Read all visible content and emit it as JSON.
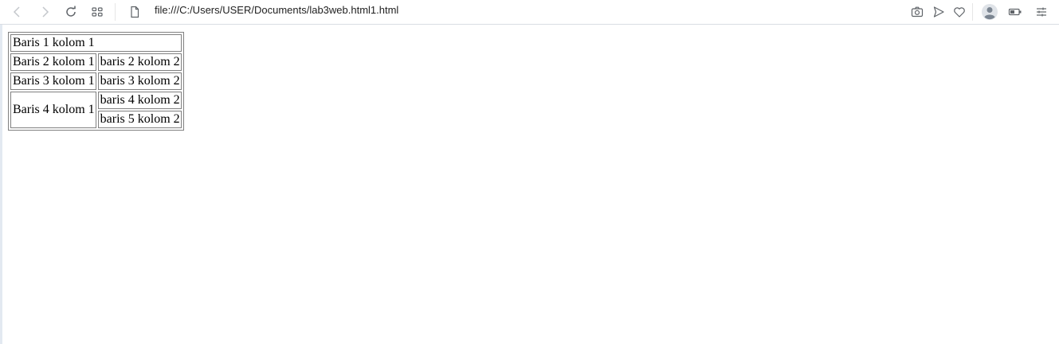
{
  "browser": {
    "url": "file:///C:/Users/USER/Documents/lab3web.html1.html",
    "icons": {
      "back": "arrow-left-icon",
      "forward": "arrow-right-icon",
      "reload": "reload-icon",
      "tabs": "grid-icon",
      "page": "document-icon",
      "snapshot": "camera-icon",
      "send": "send-icon",
      "bookmark": "heart-icon",
      "profile": "user-avatar-icon",
      "battery": "battery-icon",
      "menu": "menu-icon"
    }
  },
  "table": {
    "row1": {
      "col1": "Baris 1 kolom 1"
    },
    "row2": {
      "col1": "Baris 2 kolom 1",
      "col2": "baris 2 kolom 2"
    },
    "row3": {
      "col1": "Baris 3 kolom 1",
      "col2": "baris 3 kolom 2"
    },
    "row4": {
      "col1": "Baris 4 kolom 1",
      "col2": "baris 4 kolom 2"
    },
    "row5": {
      "col2": "baris 5 kolom 2"
    }
  },
  "colors": {
    "toolbar_icon": "#5f6368",
    "toolbar_icon_disabled": "#c4c7cc",
    "toolbar_border": "#d9dde3",
    "table_border": "#808080",
    "left_strip": "#e3e9f1"
  }
}
